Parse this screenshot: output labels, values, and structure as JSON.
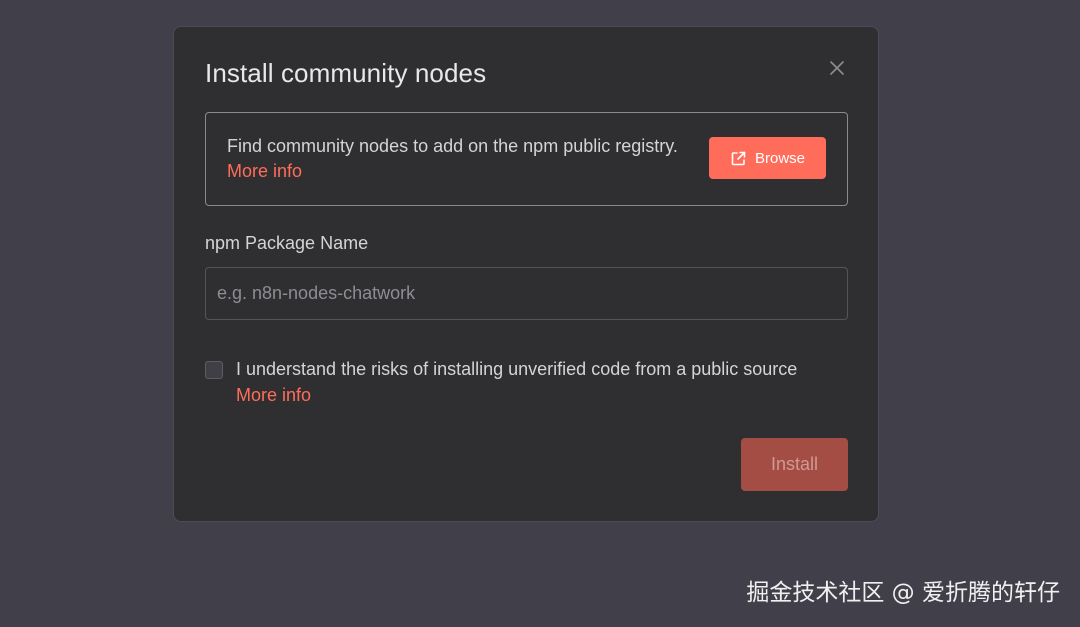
{
  "modal": {
    "title": "Install community nodes",
    "close_icon": "close-icon"
  },
  "info": {
    "text": "Find community nodes to add on the npm public registry.",
    "link_text": "More info",
    "browse_label": "Browse",
    "browse_icon": "external-link-icon"
  },
  "package": {
    "label": "npm Package Name",
    "placeholder": "e.g. n8n-nodes-chatwork",
    "value": ""
  },
  "consent": {
    "checked": false,
    "text": "I understand the risks of installing unverified code from a public source",
    "link_text": "More info"
  },
  "actions": {
    "install_label": "Install",
    "install_enabled": false
  },
  "watermark": {
    "text": "掘金技术社区 @ 爱折腾的轩仔"
  },
  "colors": {
    "backdrop": "#41404a",
    "modal_bg": "#2f2f31",
    "accent": "#ff6d5a",
    "accent_disabled": "#a34d44",
    "text": "#d4d4d7"
  }
}
